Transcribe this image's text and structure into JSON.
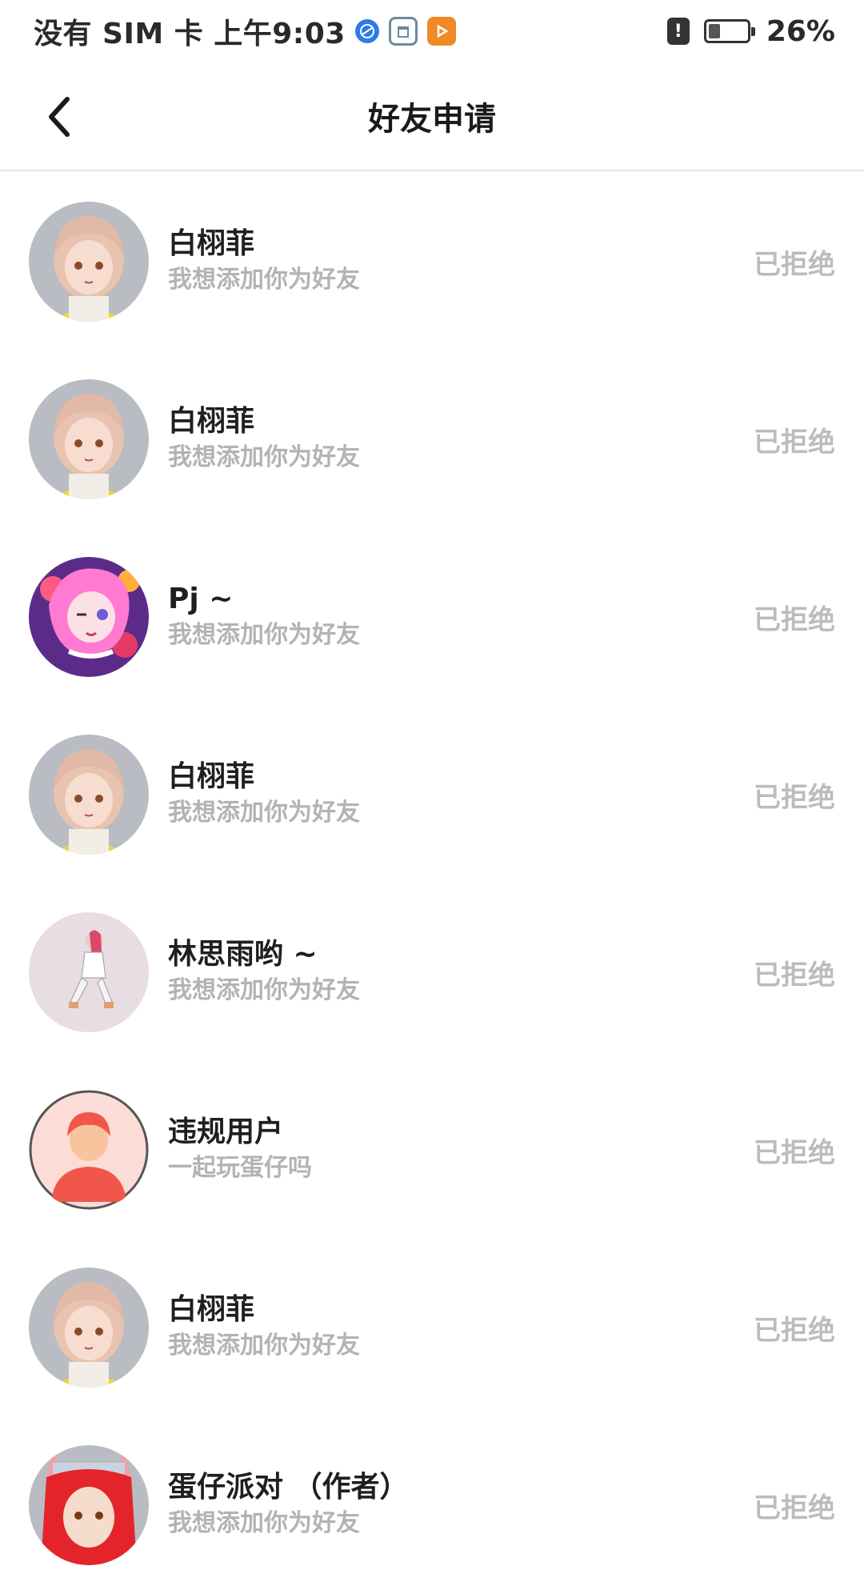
{
  "status_bar": {
    "carrier_time": "没有 SIM 卡 上午9:03",
    "battery_percent": "26%",
    "battery_level": 0.26,
    "icons": [
      "browser-icon",
      "recycle-icon",
      "video-app-icon",
      "alert-icon",
      "battery-icon"
    ]
  },
  "header": {
    "title": "好友申请",
    "back_icon": "chevron-left-icon"
  },
  "colors": {
    "title_text": "#1a1a1a",
    "secondary_text": "#b3b3b3",
    "status_text": "#bcbcbc",
    "divider": "#e6e6e6"
  },
  "requests": [
    {
      "name": "白栩菲",
      "message": "我想添加你为好友",
      "status": "已拒绝",
      "avatar": "anime-girl-avatar"
    },
    {
      "name": "白栩菲",
      "message": "我想添加你为好友",
      "status": "已拒绝",
      "avatar": "anime-girl-avatar"
    },
    {
      "name": "Pj ~",
      "message": "我想添加你为好友",
      "status": "已拒绝",
      "avatar": "pink-hair-avatar"
    },
    {
      "name": "白栩菲",
      "message": "我想添加你为好友",
      "status": "已拒绝",
      "avatar": "anime-girl-avatar"
    },
    {
      "name": "林思雨哟 ~",
      "message": "我想添加你为好友",
      "status": "已拒绝",
      "avatar": "sitting-figure-avatar"
    },
    {
      "name": "违规用户",
      "message": "一起玩蛋仔吗",
      "status": "已拒绝",
      "avatar": "default-user-avatar"
    },
    {
      "name": "白栩菲",
      "message": "我想添加你为好友",
      "status": "已拒绝",
      "avatar": "anime-girl-avatar"
    },
    {
      "name": "蛋仔派对 （作者）",
      "message": "我想添加你为好友",
      "status": "已拒绝",
      "avatar": "red-hair-cat-ears-avatar"
    }
  ]
}
